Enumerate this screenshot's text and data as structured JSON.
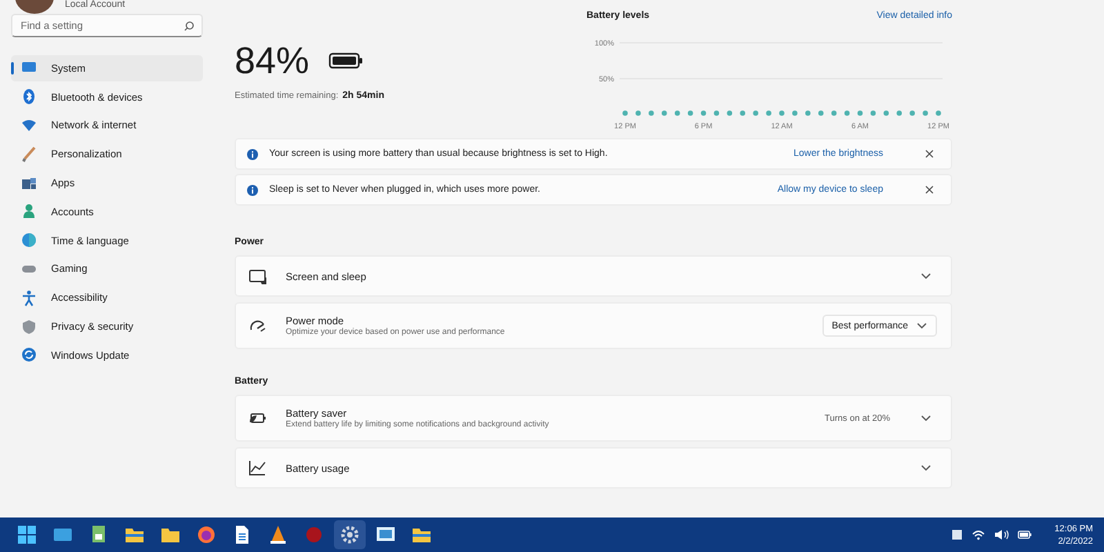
{
  "account": {
    "name": "Local Account"
  },
  "search": {
    "placeholder": "Find a setting"
  },
  "sidebar": {
    "items": [
      {
        "label": "System",
        "selected": true
      },
      {
        "label": "Bluetooth & devices",
        "selected": false
      },
      {
        "label": "Network & internet",
        "selected": false
      },
      {
        "label": "Personalization",
        "selected": false
      },
      {
        "label": "Apps",
        "selected": false
      },
      {
        "label": "Accounts",
        "selected": false
      },
      {
        "label": "Time & language",
        "selected": false
      },
      {
        "label": "Gaming",
        "selected": false
      },
      {
        "label": "Accessibility",
        "selected": false
      },
      {
        "label": "Privacy & security",
        "selected": false
      },
      {
        "label": "Windows Update",
        "selected": false
      }
    ]
  },
  "summary": {
    "percent": "84%",
    "estimate_label": "Estimated time remaining:",
    "estimate_value": "2h 54min"
  },
  "battery_levels": {
    "title": "Battery levels",
    "link": "View detailed info",
    "y_labels": [
      "100%",
      "50%"
    ],
    "x_labels": [
      "12 PM",
      "6 PM",
      "12 AM",
      "6 AM",
      "12 PM"
    ]
  },
  "notices": [
    {
      "text": "Your screen is using more battery than usual because brightness is set to High.",
      "action": "Lower the brightness"
    },
    {
      "text": "Sleep is set to Never when plugged in, which uses more power.",
      "action": "Allow my device to sleep"
    }
  ],
  "sections": [
    {
      "title": "Power",
      "rows": [
        {
          "kind": "expander",
          "label": "Screen and sleep"
        },
        {
          "kind": "dropdown",
          "label": "Power mode",
          "description": "Optimize your device based on power use and performance",
          "value": "Best performance"
        }
      ]
    },
    {
      "title": "Battery",
      "rows": [
        {
          "kind": "expander",
          "label": "Battery saver",
          "description": "Extend battery life by limiting some notifications and background activity",
          "status": "Turns on at 20%"
        },
        {
          "kind": "expander",
          "label": "Battery usage"
        }
      ]
    }
  ],
  "taskbar": {
    "time": "12:06 PM",
    "date": "2/2/2022"
  }
}
